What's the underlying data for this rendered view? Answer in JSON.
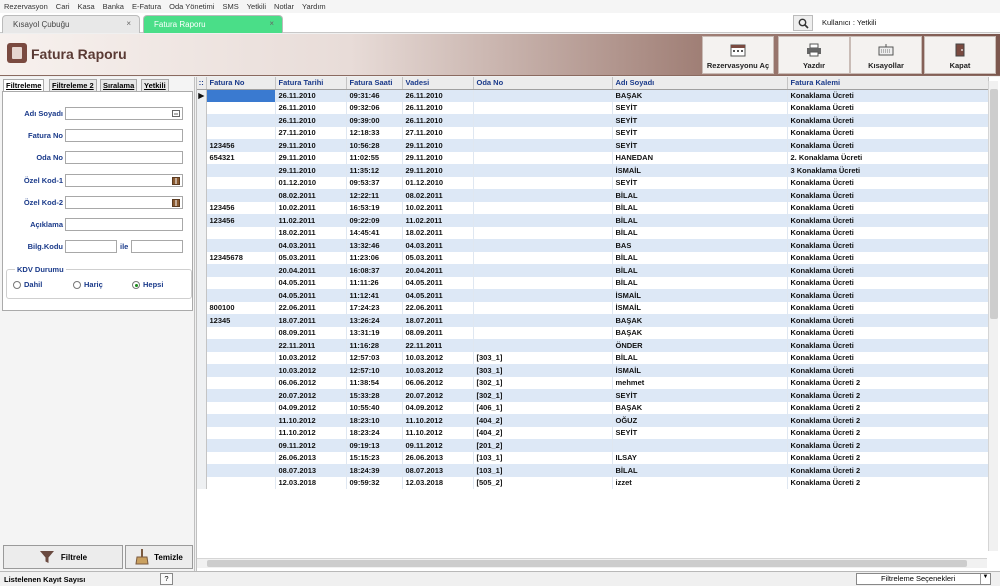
{
  "menu": [
    "Rezervasyon",
    "Cari",
    "Kasa",
    "Banka",
    "E-Fatura",
    "Oda Yönetimi",
    "SMS",
    "Yetkili",
    "Notlar",
    "Yardım"
  ],
  "tabs": [
    {
      "label": "Kısayol Çubuğu",
      "close": "×"
    },
    {
      "label": "Fatura Raporu",
      "close": "×"
    }
  ],
  "user_label": "Kullanıcı : Yetkili",
  "header": {
    "title": "Fatura Raporu",
    "buttons": [
      {
        "label": "Rezervasyonu Aç",
        "icon": "calendar-icon"
      },
      {
        "label": "Yazdır",
        "icon": "printer-icon"
      },
      {
        "label": "Kısayollar",
        "icon": "keyboard-icon"
      },
      {
        "label": "Kapat",
        "icon": "exit-door-icon"
      }
    ]
  },
  "filter": {
    "tabs": [
      "Filtreleme",
      "Filtreleme 2",
      "Sıralama",
      "Yetkili"
    ],
    "fields": {
      "adi_soyadi": "Adı Soyadı",
      "fatura_no": "Fatura No",
      "oda_no": "Oda No",
      "ozel_kod1": "Özel Kod-1",
      "ozel_kod2": "Özel Kod-2",
      "aciklama": "Açıklama",
      "bilg_kodu": "Bilg.Kodu",
      "ile": "ile"
    },
    "kdv": {
      "title": "KDV Durumu",
      "options": [
        "Dahil",
        "Hariç",
        "Hepsi"
      ],
      "selected": "Hepsi"
    },
    "buttons": {
      "filter": "Filtrele",
      "clear": "Temizle"
    }
  },
  "grid": {
    "columns": [
      "Fatura No",
      "Fatura Tarihi",
      "Fatura Saati",
      "Vadesi",
      "Oda No",
      "Adı Soyadı",
      "Fatura Kalemi"
    ],
    "rows": [
      [
        "",
        "26.11.2010",
        "09:31:46",
        "26.11.2010",
        "",
        "BAŞAK",
        "Konaklama Ücreti"
      ],
      [
        "",
        "26.11.2010",
        "09:32:06",
        "26.11.2010",
        "",
        "SEYİT",
        "Konaklama Ücreti"
      ],
      [
        "",
        "26.11.2010",
        "09:39:00",
        "26.11.2010",
        "",
        "SEYİT",
        "Konaklama Ücreti"
      ],
      [
        "",
        "27.11.2010",
        "12:18:33",
        "27.11.2010",
        "",
        "SEYİT",
        "Konaklama Ücreti"
      ],
      [
        "123456",
        "29.11.2010",
        "10:56:28",
        "29.11.2010",
        "",
        "SEYİT",
        "Konaklama Ücreti"
      ],
      [
        "654321",
        "29.11.2010",
        "11:02:55",
        "29.11.2010",
        "",
        "HANEDAN",
        "2. Konaklama Ücreti"
      ],
      [
        "",
        "29.11.2010",
        "11:35:12",
        "29.11.2010",
        "",
        "İSMAİL",
        "3 Konaklama Ücreti"
      ],
      [
        "",
        "01.12.2010",
        "09:53:37",
        "01.12.2010",
        "",
        "SEYİT",
        "Konaklama Ücreti"
      ],
      [
        "",
        "08.02.2011",
        "12:22:11",
        "08.02.2011",
        "",
        "BİLAL",
        "Konaklama Ücreti"
      ],
      [
        "123456",
        "10.02.2011",
        "16:53:19",
        "10.02.2011",
        "",
        "BİLAL",
        "Konaklama Ücreti"
      ],
      [
        "123456",
        "11.02.2011",
        "09:22:09",
        "11.02.2011",
        "",
        "BİLAL",
        "Konaklama Ücreti"
      ],
      [
        "",
        "18.02.2011",
        "14:45:41",
        "18.02.2011",
        "",
        "BİLAL",
        "Konaklama Ücreti"
      ],
      [
        "",
        "04.03.2011",
        "13:32:46",
        "04.03.2011",
        "",
        "BAS",
        "Konaklama Ücreti"
      ],
      [
        "12345678",
        "05.03.2011",
        "11:23:06",
        "05.03.2011",
        "",
        "BİLAL",
        "Konaklama Ücreti"
      ],
      [
        "",
        "20.04.2011",
        "16:08:37",
        "20.04.2011",
        "",
        "BİLAL",
        "Konaklama Ücreti"
      ],
      [
        "",
        "04.05.2011",
        "11:11:26",
        "04.05.2011",
        "",
        "BİLAL",
        "Konaklama Ücreti"
      ],
      [
        "",
        "04.05.2011",
        "11:12:41",
        "04.05.2011",
        "",
        "İSMAİL",
        "Konaklama Ücreti"
      ],
      [
        "800100",
        "22.06.2011",
        "17:24:23",
        "22.06.2011",
        "",
        "İSMAİL",
        "Konaklama Ücreti"
      ],
      [
        "12345",
        "18.07.2011",
        "13:26:24",
        "18.07.2011",
        "",
        "BAŞAK",
        "Konaklama Ücreti"
      ],
      [
        "",
        "08.09.2011",
        "13:31:19",
        "08.09.2011",
        "",
        "BAŞAK",
        "Konaklama Ücreti"
      ],
      [
        "",
        "22.11.2011",
        "11:16:28",
        "22.11.2011",
        "",
        "ÖNDER",
        "Konaklama Ücreti"
      ],
      [
        "",
        "10.03.2012",
        "12:57:03",
        "10.03.2012",
        "[303_1]",
        "BİLAL",
        "Konaklama Ücreti"
      ],
      [
        "",
        "10.03.2012",
        "12:57:10",
        "10.03.2012",
        "[303_1]",
        "İSMAİL",
        "Konaklama Ücreti"
      ],
      [
        "",
        "06.06.2012",
        "11:38:54",
        "06.06.2012",
        "[302_1]",
        "mehmet",
        "Konaklama Ücreti 2"
      ],
      [
        "",
        "20.07.2012",
        "15:33:28",
        "20.07.2012",
        "[302_1]",
        "SEYİT",
        "Konaklama Ücreti 2"
      ],
      [
        "",
        "04.09.2012",
        "10:55:40",
        "04.09.2012",
        "[406_1]",
        "BAŞAK",
        "Konaklama Ücreti 2"
      ],
      [
        "",
        "11.10.2012",
        "18:23:10",
        "11.10.2012",
        "[404_2]",
        "OĞUZ",
        "Konaklama Ücreti 2"
      ],
      [
        "",
        "11.10.2012",
        "18:23:24",
        "11.10.2012",
        "[404_2]",
        "SEYİT",
        "Konaklama Ücreti 2"
      ],
      [
        "",
        "09.11.2012",
        "09:19:13",
        "09.11.2012",
        "[201_2]",
        "",
        "Konaklama Ücreti 2"
      ],
      [
        "",
        "26.06.2013",
        "15:15:23",
        "26.06.2013",
        "[103_1]",
        "ILSAY",
        "Konaklama Ücreti 2"
      ],
      [
        "",
        "08.07.2013",
        "18:24:39",
        "08.07.2013",
        "[103_1]",
        "BİLAL",
        "Konaklama Ücreti 2"
      ],
      [
        "",
        "12.03.2018",
        "09:59:32",
        "12.03.2018",
        "[505_2]",
        "izzet",
        "Konaklama Ücreti 2"
      ]
    ]
  },
  "status": {
    "label": "Listelenen Kayıt Sayısı",
    "help": "?",
    "filter_options": "Filtreleme Seçenekleri"
  }
}
